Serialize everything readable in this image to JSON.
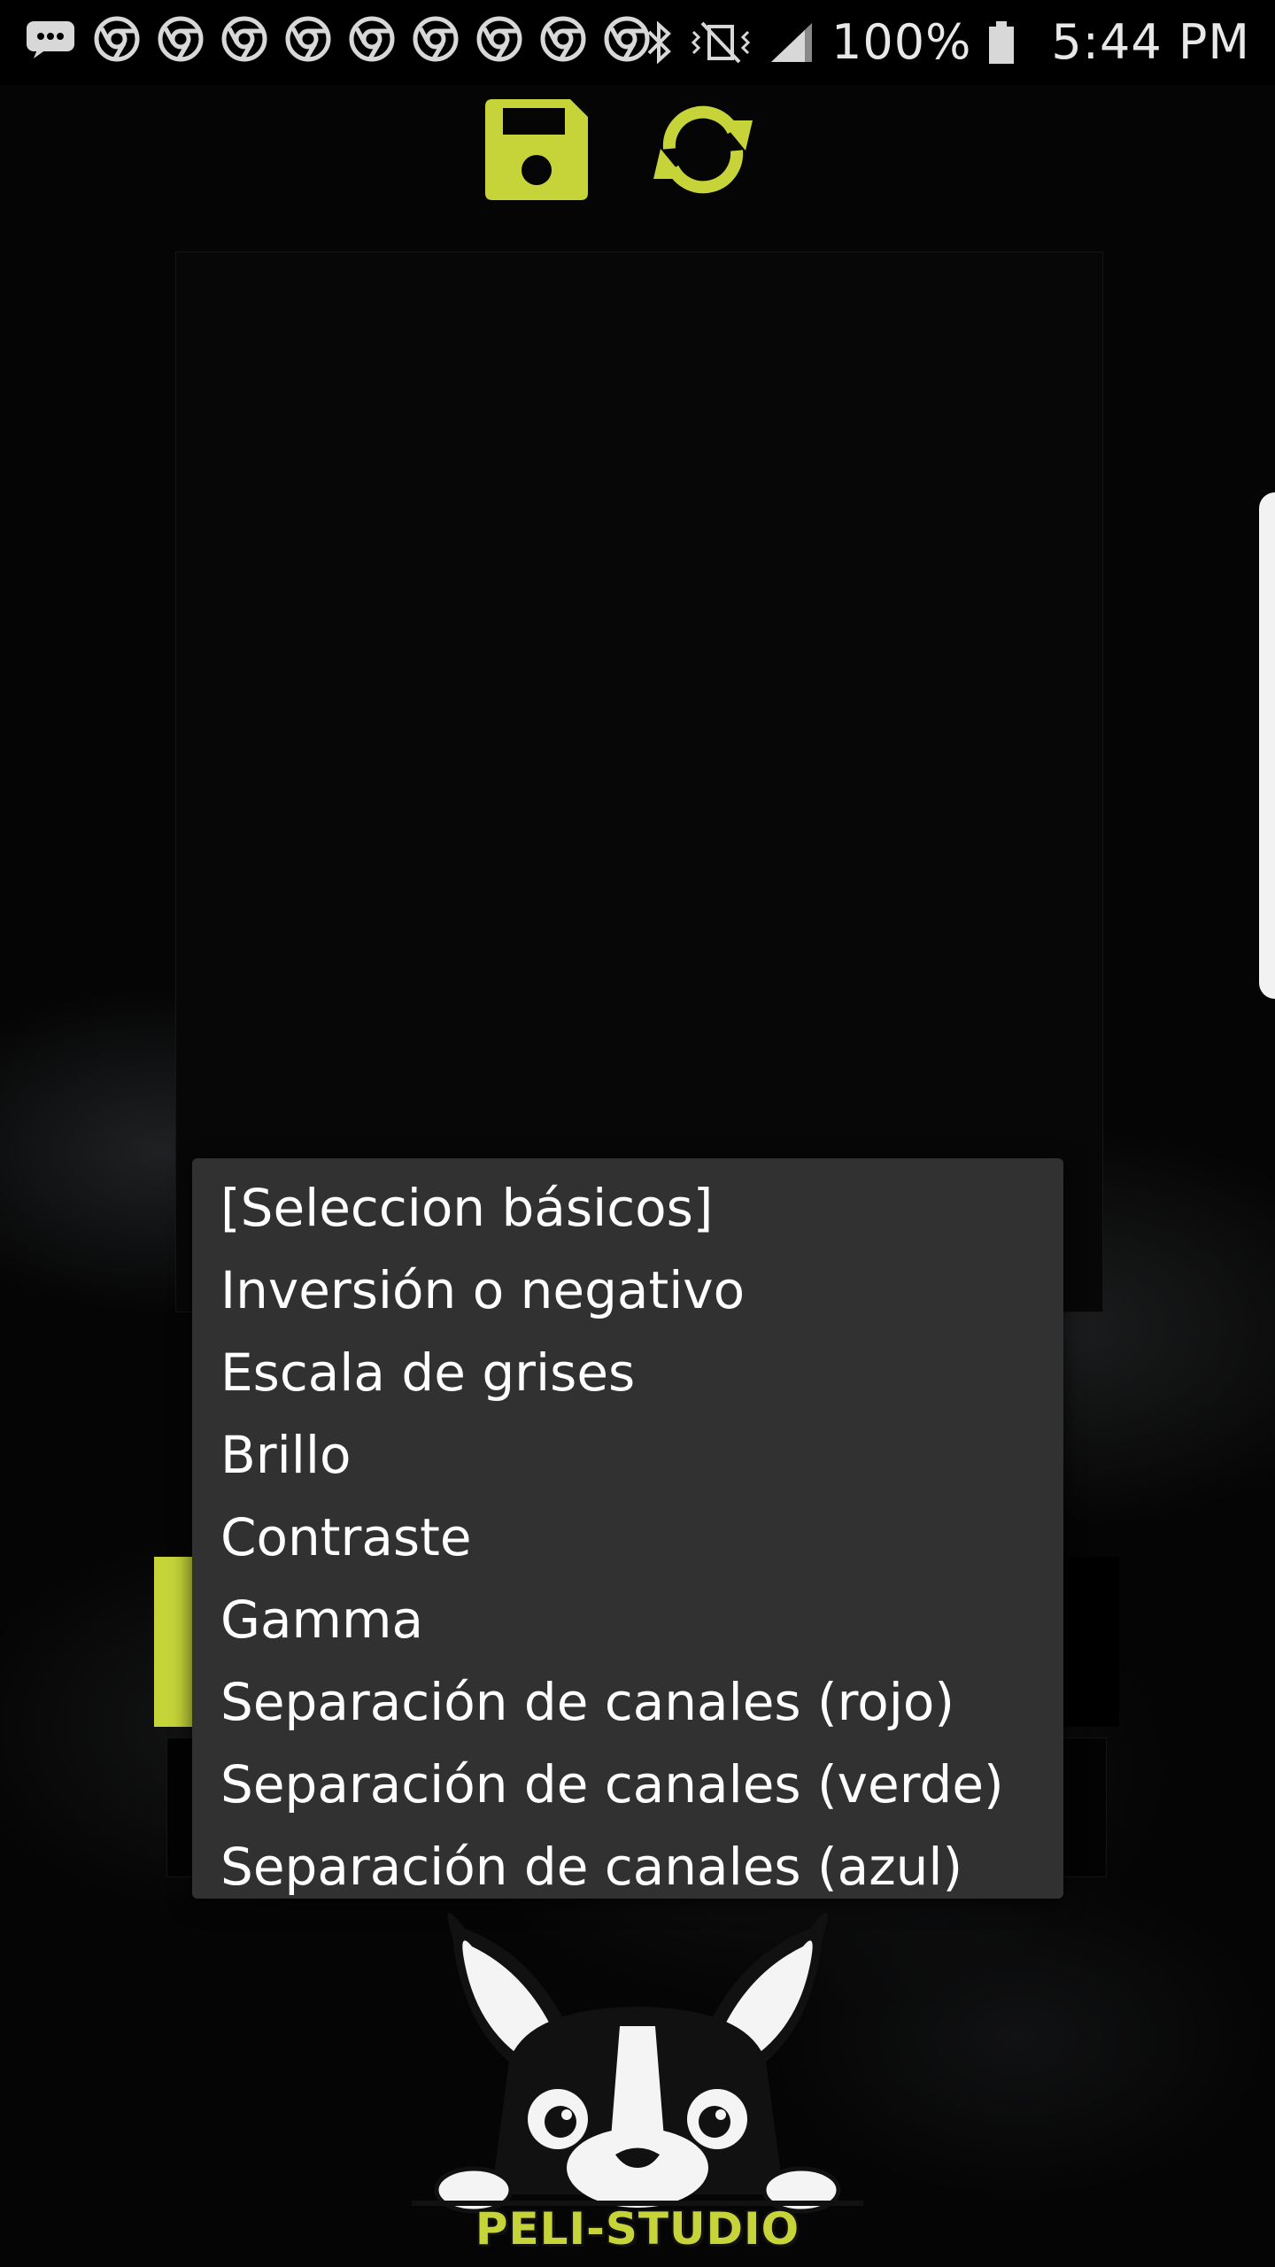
{
  "status_bar": {
    "battery": "100%",
    "time": "5:44 PM",
    "notification_icons": [
      "message-icon",
      "chrome-icon",
      "chrome-icon",
      "chrome-icon",
      "chrome-icon",
      "chrome-icon",
      "chrome-icon",
      "chrome-icon",
      "chrome-icon",
      "chrome-icon"
    ],
    "system_icons": [
      "bluetooth-icon",
      "vibrate-icon",
      "signal-icon",
      "battery-icon"
    ]
  },
  "toolbar": {
    "save_icon": "floppy-save-icon",
    "refresh_icon": "sync-refresh-icon",
    "accent_color": "#c6d43a"
  },
  "dropdown": {
    "options": [
      "[Seleccion básicos]",
      "Inversión o negativo",
      "Escala de grises",
      "Brillo",
      "Contraste",
      "Gamma",
      "Separación de canales (rojo)",
      "Separación de canales (verde)",
      "Separación de canales (azul)"
    ],
    "background": "#313131"
  },
  "logo": {
    "text": "PELI-STUDIO",
    "icon": "french-bulldog-logo"
  }
}
